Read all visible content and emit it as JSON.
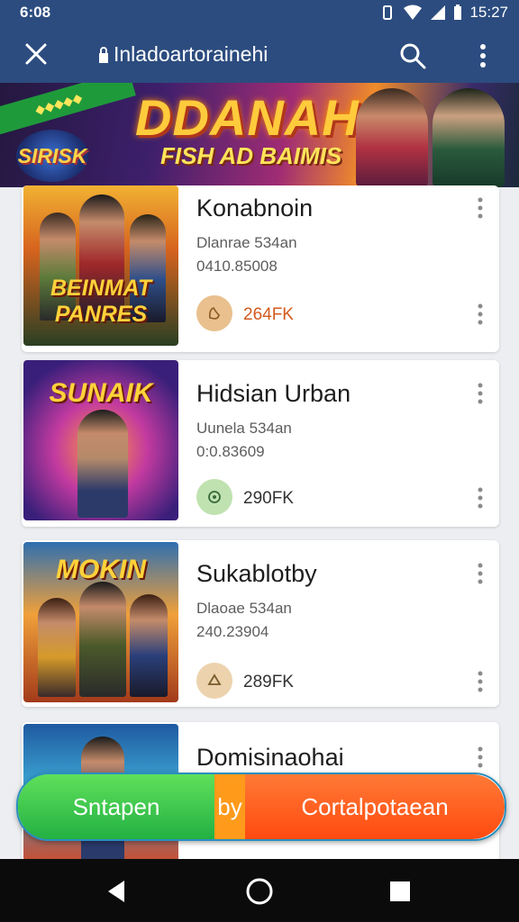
{
  "status_bar": {
    "time": "6:08",
    "clock": "15:27"
  },
  "app_bar": {
    "title": "Inladoartorainehi"
  },
  "banner": {
    "ribbon_text": "◆◆◆◆◆",
    "badge_text": "SIRISK",
    "headline": "DDANAHM",
    "subline": "FISH AD BAIMIS"
  },
  "games": [
    {
      "name": "Konabnoin",
      "meta_line1": "Dlanrae 534an",
      "meta_line2": "0410.85008",
      "price": "264FK",
      "thumb_title": "BEINMAT PANRES",
      "coin_color": "#e9c08e",
      "accent": "#d35a1e"
    },
    {
      "name": "Hidsian Urban",
      "meta_line1": "Uunela 534an",
      "meta_line2": "0:0.83609",
      "price": "290FK",
      "thumb_title": "SUNAIK",
      "coin_color": "#bfe2b0",
      "accent": "#333333"
    },
    {
      "name": "Sukablotby",
      "meta_line1": "Dlaoae 534an",
      "meta_line2": "240.23904",
      "price": "289FK",
      "thumb_title": "MOKIN",
      "coin_color": "#ecd3ae",
      "accent": "#333333"
    },
    {
      "name": "Domisinaohai",
      "meta_line1": "",
      "meta_line2": "",
      "price": "",
      "thumb_title": "",
      "coin_color": "#ecd3ae",
      "accent": "#333333"
    }
  ],
  "cta": {
    "left": "Sntapen",
    "mid": "by",
    "right": "Cortalpotaean"
  }
}
